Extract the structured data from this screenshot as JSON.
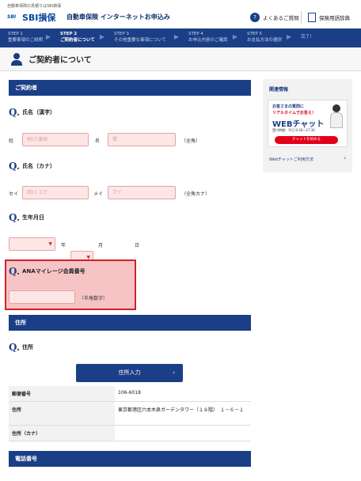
{
  "header": {
    "top_note": "自動車保険の見積りはSBI損保",
    "logo_text": "SBI損保",
    "logo_mark": "SBI",
    "app_title": "自動車保険 インターネットお申込み",
    "faq_label": "よくあるご質問",
    "dict_label": "保険用語辞典"
  },
  "steps": [
    {
      "num": "STEP 1",
      "label": "重要事項のご説明"
    },
    {
      "num": "STEP 2",
      "label": "ご契約者について"
    },
    {
      "num": "STEP 3",
      "label": "その他重要な事項について"
    },
    {
      "num": "STEP 4",
      "label": "お申込内容のご確認"
    },
    {
      "num": "STEP 5",
      "label": "お支払方法の選択"
    },
    {
      "num": "",
      "label": "完了！"
    }
  ],
  "page_title": "ご契約者について",
  "contractor": {
    "section_title": "ご契約者",
    "name_kanji": {
      "question": "氏名（漢字）",
      "sei_label": "姓",
      "sei_placeholder": "例)三菱原",
      "mei_label": "名",
      "mei_placeholder": "愛",
      "note": "（全角）"
    },
    "name_kana": {
      "question": "氏名（カナ）",
      "sei_label": "セイ",
      "sei_placeholder": "例)ミエビ",
      "mei_label": "メイ",
      "mei_placeholder": "アイ",
      "note": "（全角カナ）"
    },
    "birthdate": {
      "question": "生年月日",
      "year_unit": "年",
      "month_unit": "月",
      "day_unit": "日"
    },
    "ana": {
      "question": "ANAマイレージ会員番号",
      "note": "（半角数字）"
    }
  },
  "address": {
    "section_title": "住所",
    "question": "住所",
    "button_label": "住所入力",
    "rows": [
      {
        "label": "郵便番号",
        "value": "106-6018"
      },
      {
        "label": "住所",
        "value": "東京都港区六本木泉ガーデンタワー（１８階）　１－６－１"
      },
      {
        "label": "住所（カナ）",
        "value": ""
      }
    ]
  },
  "phone": {
    "section_title": "電話番号"
  },
  "sidebar": {
    "title": "関連情報",
    "banner_line1": "お客さまの質問に",
    "banner_line2": "リアルタイムでお答え！",
    "banner_line3": "WEBチャット",
    "banner_hours": "受付時間：平日 9:30～17:30",
    "banner_cta": "チャットを始める",
    "link_label": "Webチャットご利用方法"
  },
  "colors": {
    "brand": "#1b3f86",
    "accent": "#e2001a",
    "input_bg": "#fde6e6",
    "highlight_border": "#d21f2b"
  }
}
